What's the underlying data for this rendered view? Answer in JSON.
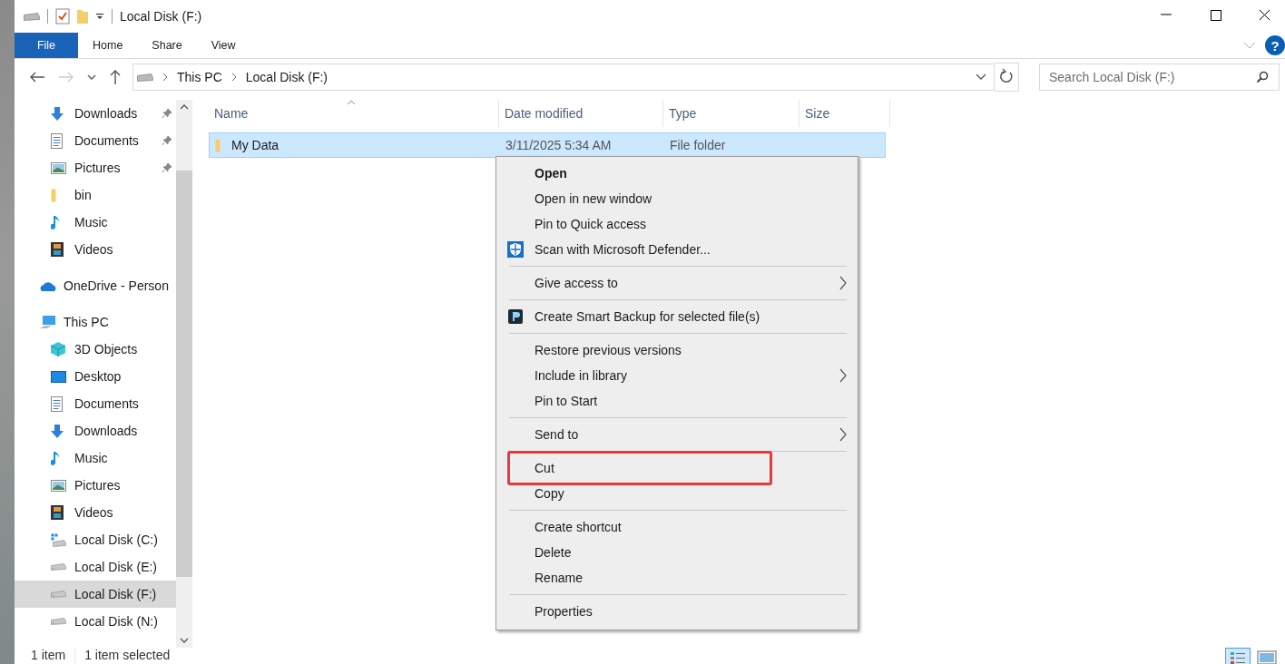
{
  "window": {
    "title": "Local Disk (F:)"
  },
  "ribbon_tabs": [
    {
      "label": "File",
      "selected": true
    },
    {
      "label": "Home",
      "selected": false
    },
    {
      "label": "Share",
      "selected": false
    },
    {
      "label": "View",
      "selected": false
    }
  ],
  "help": {
    "label": "?"
  },
  "address": {
    "crumbs": [
      "This PC",
      "Local Disk (F:)"
    ]
  },
  "search": {
    "placeholder": "Search Local Disk (F:)"
  },
  "sidebar": {
    "quick_access_children": [
      {
        "label": "Downloads",
        "kind": "download",
        "pinned": true,
        "selected": false
      },
      {
        "label": "Documents",
        "kind": "document",
        "pinned": true,
        "selected": false
      },
      {
        "label": "Pictures",
        "kind": "picture",
        "pinned": true,
        "selected": false
      },
      {
        "label": "bin",
        "kind": "folder",
        "pinned": false,
        "selected": false
      },
      {
        "label": "Music",
        "kind": "music",
        "pinned": false,
        "selected": false
      },
      {
        "label": "Videos",
        "kind": "video",
        "pinned": false,
        "selected": false
      }
    ],
    "items": [
      {
        "label": "OneDrive - Person",
        "kind": "cloud",
        "selected": false
      },
      {
        "label": "This PC",
        "kind": "pc",
        "selected": false,
        "children": [
          {
            "label": "3D Objects",
            "kind": "cube",
            "selected": false
          },
          {
            "label": "Desktop",
            "kind": "desktop",
            "selected": false
          },
          {
            "label": "Documents",
            "kind": "document",
            "selected": false
          },
          {
            "label": "Downloads",
            "kind": "download",
            "selected": false
          },
          {
            "label": "Music",
            "kind": "music",
            "selected": false
          },
          {
            "label": "Pictures",
            "kind": "picture",
            "selected": false
          },
          {
            "label": "Videos",
            "kind": "video",
            "selected": false
          },
          {
            "label": "Local Disk (C:)",
            "kind": "system-drive",
            "selected": false
          },
          {
            "label": "Local Disk (E:)",
            "kind": "drive",
            "selected": false
          },
          {
            "label": "Local Disk (F:)",
            "kind": "drive",
            "selected": true
          },
          {
            "label": "Local Disk (N:)",
            "kind": "drive",
            "selected": false
          }
        ]
      }
    ]
  },
  "table": {
    "columns": [
      "Name",
      "Date modified",
      "Type",
      "Size"
    ],
    "rows": [
      {
        "name": "My Data",
        "date_modified": "3/11/2025 5:34 AM",
        "type": "File folder",
        "selected": true
      }
    ]
  },
  "context_menu": {
    "items": [
      {
        "kind": "item",
        "label": "Open",
        "default": true,
        "submenu": false,
        "annotated": false
      },
      {
        "kind": "item",
        "label": "Open in new window",
        "default": false,
        "submenu": false,
        "annotated": false
      },
      {
        "kind": "item",
        "label": "Pin to Quick access",
        "default": false,
        "submenu": false,
        "annotated": false
      },
      {
        "kind": "shield-item",
        "label": "Scan with Microsoft Defender...",
        "default": false,
        "submenu": false,
        "annotated": false
      },
      {
        "kind": "separator"
      },
      {
        "kind": "item",
        "label": "Give access to",
        "default": false,
        "submenu": true,
        "annotated": false
      },
      {
        "kind": "separator"
      },
      {
        "kind": "backup-item",
        "label": "Create Smart Backup for selected file(s)",
        "default": false,
        "submenu": false,
        "annotated": false
      },
      {
        "kind": "separator"
      },
      {
        "kind": "item",
        "label": "Restore previous versions",
        "default": false,
        "submenu": false,
        "annotated": false
      },
      {
        "kind": "item",
        "label": "Include in library",
        "default": false,
        "submenu": true,
        "annotated": false
      },
      {
        "kind": "item",
        "label": "Pin to Start",
        "default": false,
        "submenu": false,
        "annotated": false
      },
      {
        "kind": "separator"
      },
      {
        "kind": "item",
        "label": "Send to",
        "default": false,
        "submenu": true,
        "annotated": false
      },
      {
        "kind": "separator"
      },
      {
        "kind": "item",
        "label": "Cut",
        "default": false,
        "submenu": false,
        "annotated": true
      },
      {
        "kind": "item",
        "label": "Copy",
        "default": false,
        "submenu": false,
        "annotated": false
      },
      {
        "kind": "separator"
      },
      {
        "kind": "item",
        "label": "Create shortcut",
        "default": false,
        "submenu": false,
        "annotated": false
      },
      {
        "kind": "item",
        "label": "Delete",
        "default": false,
        "submenu": false,
        "annotated": false
      },
      {
        "kind": "item",
        "label": "Rename",
        "default": false,
        "submenu": false,
        "annotated": false
      },
      {
        "kind": "separator"
      },
      {
        "kind": "item",
        "label": "Properties",
        "default": false,
        "submenu": false,
        "annotated": false
      }
    ]
  },
  "status_bar": {
    "item_count": "1 item",
    "selection": "1 item selected",
    "views": [
      {
        "kind": "details",
        "selected": true
      },
      {
        "kind": "large-icons",
        "selected": false
      }
    ]
  }
}
